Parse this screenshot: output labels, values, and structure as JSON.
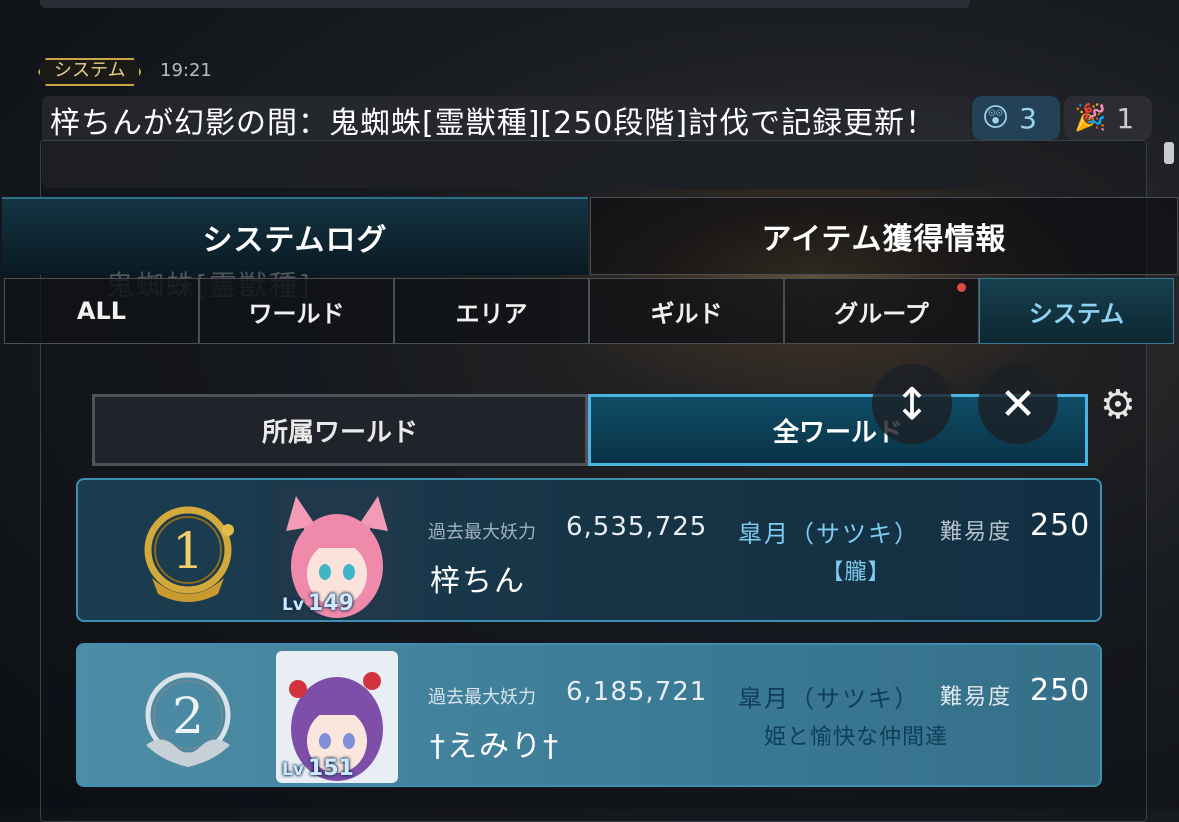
{
  "chat": {
    "tag": "システム",
    "time": "19:21",
    "message": "梓ちんが幻影の間：鬼蜘蛛[霊獣種][250段階]討伐で記録更新！",
    "reactions": [
      {
        "icon": "😲",
        "count": "3"
      },
      {
        "icon": "🎉",
        "count": "1"
      }
    ]
  },
  "tabs": {
    "main": [
      "システムログ",
      "アイテム獲得情報"
    ],
    "sub": [
      "ALL",
      "ワールド",
      "エリア",
      "ギルド",
      "グループ",
      "システム"
    ],
    "active_sub": "システム"
  },
  "faded_title": "鬼蜘蛛[霊獣種]",
  "world_toggle": [
    "所属ワールド",
    "全ワールド"
  ],
  "controls": {
    "sort_icon": "↕",
    "close_icon": "✕",
    "settings_icon": "⚙"
  },
  "ranking": [
    {
      "rank": "1",
      "level_label": "Lv",
      "level": "149",
      "past_label": "過去最大妖力",
      "past_value": "6,535,725",
      "name": "梓ちん",
      "world": "皐月（サツキ）",
      "guild": "【朧】",
      "difficulty_label": "難易度",
      "difficulty": "250"
    },
    {
      "rank": "2",
      "level_label": "Lv",
      "level": "151",
      "past_label": "過去最大妖力",
      "past_value": "6,185,721",
      "name": "†えみり†",
      "world": "皐月（サツキ）",
      "guild": "姫と愉快な仲間達",
      "difficulty_label": "難易度",
      "difficulty": "250"
    }
  ],
  "colors": {
    "accent": "#4bb4e0",
    "gold": "#c9a64a",
    "silver": "#c7d0d6"
  }
}
